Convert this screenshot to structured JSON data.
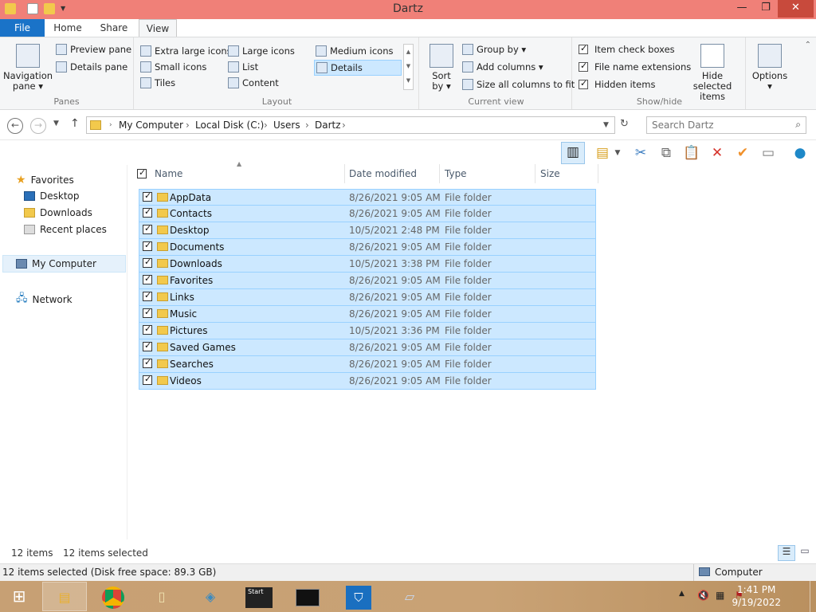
{
  "window": {
    "title": "Dartz",
    "controls": {
      "minimize": "—",
      "maximize": "❐",
      "close": "✕"
    }
  },
  "tabs": [
    {
      "label": "File"
    },
    {
      "label": "Home"
    },
    {
      "label": "Share"
    },
    {
      "label": "View"
    }
  ],
  "ribbon": {
    "panes": {
      "label": "Panes",
      "navigation_pane": "Navigation",
      "navigation_pane_line2": "pane ▾",
      "preview_pane": "Preview pane",
      "details_pane": "Details pane"
    },
    "layout": {
      "label": "Layout",
      "items": [
        "Extra large icons",
        "Large icons",
        "Medium icons",
        "Small icons",
        "List",
        "Details",
        "Tiles",
        "Content"
      ],
      "selected": "Details"
    },
    "current_view": {
      "label": "Current view",
      "sort_by": "Sort",
      "sort_by_line2": "by ▾",
      "group_by": "Group by ▾",
      "add_columns": "Add columns ▾",
      "size_all_columns": "Size all columns to fit"
    },
    "show_hide": {
      "label": "Show/hide",
      "item_check_boxes": "Item check boxes",
      "file_name_extensions": "File name extensions",
      "hidden_items": "Hidden items",
      "hide_selected": "Hide selected",
      "hide_selected_line2": "items"
    },
    "options": {
      "label": "Options",
      "arrow": "▾"
    }
  },
  "address": {
    "crumbs": [
      "My Computer",
      "Local Disk (C:)",
      "Users",
      "Dartz"
    ],
    "search_placeholder": "Search Dartz"
  },
  "nav": {
    "favorites": "Favorites",
    "desktop": "Desktop",
    "downloads": "Downloads",
    "recent": "Recent places",
    "computer": "My Computer",
    "network": "Network"
  },
  "columns": {
    "name": "Name",
    "date": "Date modified",
    "type": "Type",
    "size": "Size"
  },
  "files": [
    {
      "name": "AppData",
      "date": "8/26/2021 9:05 AM",
      "type": "File folder"
    },
    {
      "name": "Contacts",
      "date": "8/26/2021 9:05 AM",
      "type": "File folder"
    },
    {
      "name": "Desktop",
      "date": "10/5/2021 2:48 PM",
      "type": "File folder"
    },
    {
      "name": "Documents",
      "date": "8/26/2021 9:05 AM",
      "type": "File folder"
    },
    {
      "name": "Downloads",
      "date": "10/5/2021 3:38 PM",
      "type": "File folder"
    },
    {
      "name": "Favorites",
      "date": "8/26/2021 9:05 AM",
      "type": "File folder"
    },
    {
      "name": "Links",
      "date": "8/26/2021 9:05 AM",
      "type": "File folder"
    },
    {
      "name": "Music",
      "date": "8/26/2021 9:05 AM",
      "type": "File folder"
    },
    {
      "name": "Pictures",
      "date": "10/5/2021 3:36 PM",
      "type": "File folder"
    },
    {
      "name": "Saved Games",
      "date": "8/26/2021 9:05 AM",
      "type": "File folder"
    },
    {
      "name": "Searches",
      "date": "8/26/2021 9:05 AM",
      "type": "File folder"
    },
    {
      "name": "Videos",
      "date": "8/26/2021 9:05 AM",
      "type": "File folder"
    }
  ],
  "status": {
    "item_count": "12 items",
    "selected_count": "12 items selected",
    "bottom": "12 items selected (Disk free space: 89.3 GB)",
    "location": "Computer"
  },
  "taskbar": {
    "time": "1:41 PM",
    "date": "9/19/2022",
    "cmd_label": "Start"
  },
  "colors": {
    "titlebar": "#f08078",
    "file_tab": "#1a73c8",
    "selection": "#cce8ff"
  }
}
